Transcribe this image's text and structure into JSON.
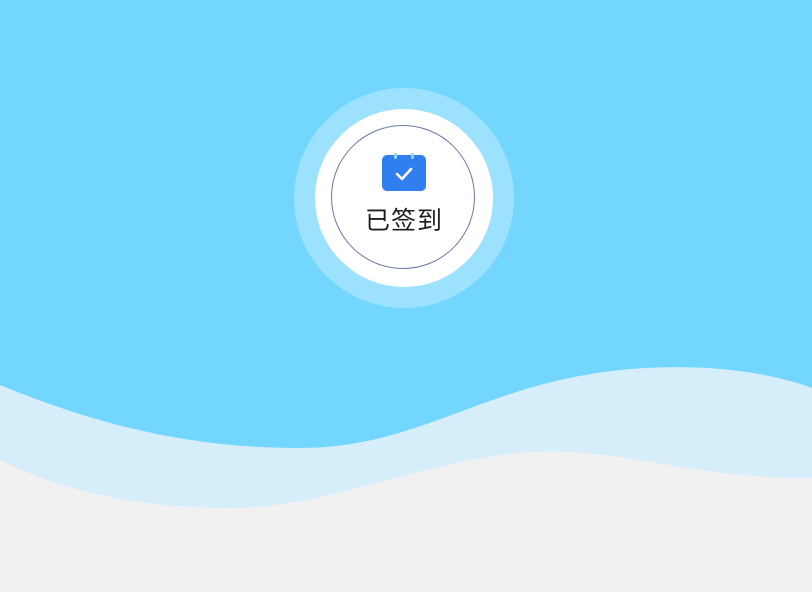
{
  "checkin": {
    "status_label": "已签到",
    "icon": "calendar-check-icon"
  },
  "colors": {
    "sky": "#72d6ff",
    "wave_light": "#d6eefa",
    "ground": "#f1f1f1",
    "icon_blue": "#2f7ff0",
    "ring": "#6878a8"
  }
}
